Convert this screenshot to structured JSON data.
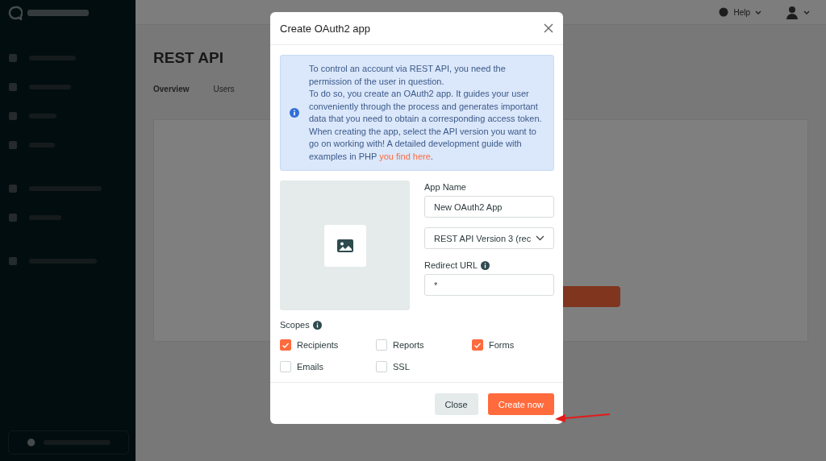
{
  "topbar": {
    "help": "Help"
  },
  "page": {
    "title": "REST API",
    "tabs": [
      {
        "label": "Overview",
        "selected": true
      },
      {
        "label": "Users",
        "selected": false
      }
    ]
  },
  "modal": {
    "title": "Create OAuth2 app",
    "info": {
      "paragraphs": [
        "To control an account via REST API, you need the permission of the user in question.",
        "To do so, you create an OAuth2 app. It guides your user conveniently through the process and generates important data that you need to obtain a corresponding access token."
      ],
      "last_before": "When creating the app, select the API version you want to go on working with! A detailed development guide with examples in PHP ",
      "link": "you find here",
      "last_after": "."
    },
    "app_name": {
      "label": "App Name",
      "value": "New OAuth2 App"
    },
    "api_version": {
      "value": "REST API Version 3 (rec"
    },
    "redirect_url": {
      "label": "Redirect URL",
      "value": "*"
    },
    "scopes": {
      "label": "Scopes",
      "items": [
        {
          "label": "Recipients",
          "checked": true
        },
        {
          "label": "Reports",
          "checked": false
        },
        {
          "label": "Forms",
          "checked": true
        },
        {
          "label": "Emails",
          "checked": false
        },
        {
          "label": "SSL",
          "checked": false
        }
      ]
    },
    "buttons": {
      "close": "Close",
      "create": "Create now"
    }
  }
}
